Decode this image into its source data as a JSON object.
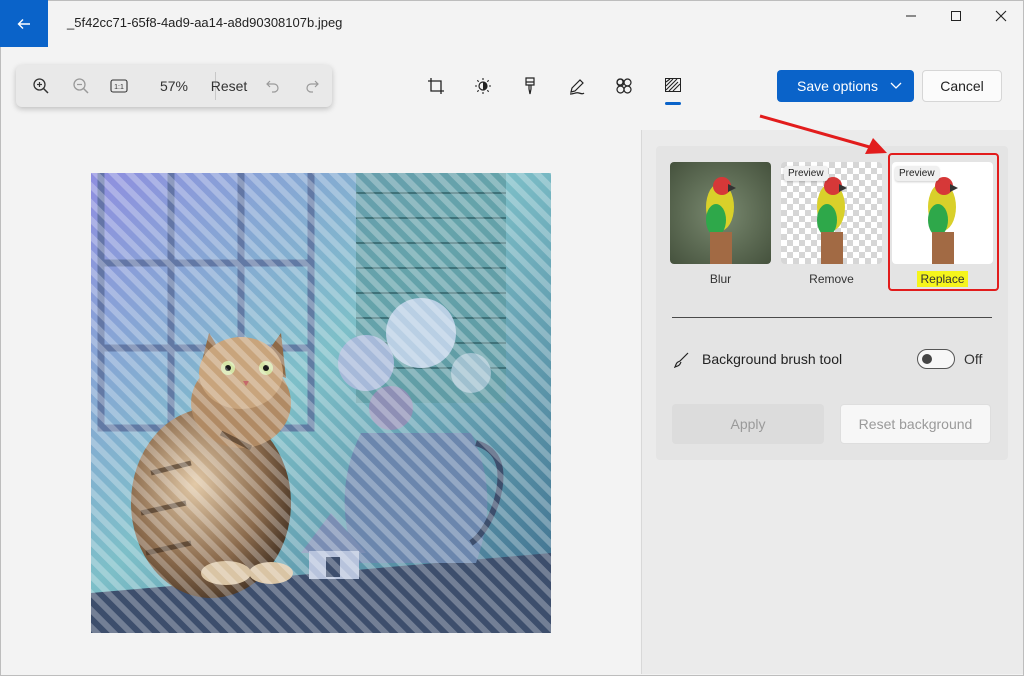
{
  "window": {
    "title": "_5f42cc71-65f8-4ad9-aa14-a8d90308107b.jpeg"
  },
  "zoombar": {
    "zoom_value": "57%",
    "reset_label": "Reset"
  },
  "tools": [
    {
      "name": "crop-icon"
    },
    {
      "name": "brightness-icon"
    },
    {
      "name": "retouch-brush-icon"
    },
    {
      "name": "markup-pen-icon"
    },
    {
      "name": "filter-icon"
    },
    {
      "name": "background-icon",
      "active": true
    }
  ],
  "actions": {
    "save_label": "Save options",
    "cancel_label": "Cancel"
  },
  "background_panel": {
    "options": [
      {
        "label": "Blur",
        "badge": ""
      },
      {
        "label": "Remove",
        "badge": "Preview"
      },
      {
        "label": "Replace",
        "badge": "Preview",
        "selected": true
      }
    ],
    "brush_tool_label": "Background brush tool",
    "brush_toggle_state": "Off",
    "apply_label": "Apply",
    "reset_background_label": "Reset background"
  },
  "colors": {
    "accent": "#0a63c9",
    "highlight_box": "#e21c1c",
    "label_highlight": "#f5f51c"
  }
}
